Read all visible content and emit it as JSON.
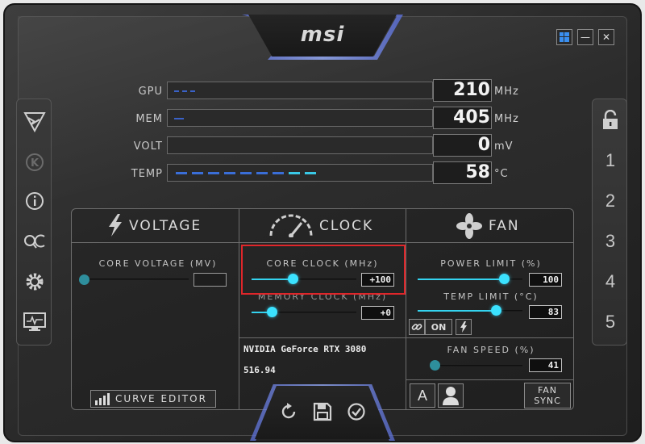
{
  "brand": {
    "logo_text": "msi"
  },
  "window_controls": {
    "min_label": "—",
    "close_label": "✕"
  },
  "left_sidebar": [
    {
      "name": "oc-scanner-icon",
      "state": "active"
    },
    {
      "name": "kombustor-icon",
      "state": "dim"
    },
    {
      "name": "info-icon",
      "state": "active"
    },
    {
      "name": "oc-icon",
      "state": "active"
    },
    {
      "name": "settings-gear-icon",
      "state": "active"
    },
    {
      "name": "monitor-icon",
      "state": "active"
    }
  ],
  "right_sidebar": {
    "lock": "lock-open-icon",
    "profiles": [
      "1",
      "2",
      "3",
      "4",
      "5"
    ]
  },
  "monitors": {
    "gpu": {
      "label": "GPU",
      "value": "210",
      "unit": "MHz",
      "fill_fraction": 0.09
    },
    "mem": {
      "label": "MEM",
      "value": "405",
      "unit": "MHz",
      "fill_fraction": 0.04
    },
    "volt": {
      "label": "VOLT",
      "value": "0",
      "unit": "mV",
      "fill_fraction": 0.0
    },
    "temp": {
      "label": "TEMP",
      "value": "58",
      "unit": "°C",
      "fill_fraction": 0.58
    }
  },
  "voltage": {
    "title": "VOLTAGE",
    "core_voltage_label": "CORE VOLTAGE  (MV)",
    "core_voltage_value": "",
    "curve_editor_label": "CURVE EDITOR"
  },
  "clock": {
    "title": "CLOCK",
    "core_clock_label": "CORE CLOCK (MHz)",
    "core_clock_value": "+100",
    "memory_clock_label": "MEMORY CLOCK (MHz)",
    "memory_clock_value": "+0",
    "gpu_name": "NVIDIA GeForce RTX 3080",
    "driver_version": "516.94"
  },
  "fan": {
    "title": "FAN",
    "power_limit_label": "POWER LIMIT (%)",
    "power_limit_value": "100",
    "temp_limit_label": "TEMP LIMIT (°C)",
    "temp_limit_value": "83",
    "link_state_label": "ON",
    "fan_speed_label": "FAN SPEED (%)",
    "fan_speed_value": "41",
    "auto_label": "A",
    "fan_sync_line1": "FAN",
    "fan_sync_line2": "SYNC"
  },
  "colors": {
    "accent": "#3be2ff",
    "highlight_box": "#e0262a",
    "temp_bar": "#3a8ed8"
  }
}
